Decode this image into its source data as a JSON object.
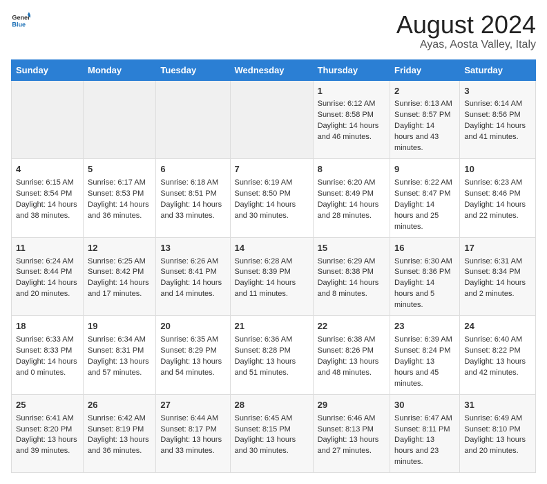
{
  "header": {
    "logo_general": "General",
    "logo_blue": "Blue",
    "title": "August 2024",
    "subtitle": "Ayas, Aosta Valley, Italy"
  },
  "days_of_week": [
    "Sunday",
    "Monday",
    "Tuesday",
    "Wednesday",
    "Thursday",
    "Friday",
    "Saturday"
  ],
  "weeks": [
    [
      {
        "day": "",
        "content": ""
      },
      {
        "day": "",
        "content": ""
      },
      {
        "day": "",
        "content": ""
      },
      {
        "day": "",
        "content": ""
      },
      {
        "day": "1",
        "content": "Sunrise: 6:12 AM\nSunset: 8:58 PM\nDaylight: 14 hours and 46 minutes."
      },
      {
        "day": "2",
        "content": "Sunrise: 6:13 AM\nSunset: 8:57 PM\nDaylight: 14 hours and 43 minutes."
      },
      {
        "day": "3",
        "content": "Sunrise: 6:14 AM\nSunset: 8:56 PM\nDaylight: 14 hours and 41 minutes."
      }
    ],
    [
      {
        "day": "4",
        "content": "Sunrise: 6:15 AM\nSunset: 8:54 PM\nDaylight: 14 hours and 38 minutes."
      },
      {
        "day": "5",
        "content": "Sunrise: 6:17 AM\nSunset: 8:53 PM\nDaylight: 14 hours and 36 minutes."
      },
      {
        "day": "6",
        "content": "Sunrise: 6:18 AM\nSunset: 8:51 PM\nDaylight: 14 hours and 33 minutes."
      },
      {
        "day": "7",
        "content": "Sunrise: 6:19 AM\nSunset: 8:50 PM\nDaylight: 14 hours and 30 minutes."
      },
      {
        "day": "8",
        "content": "Sunrise: 6:20 AM\nSunset: 8:49 PM\nDaylight: 14 hours and 28 minutes."
      },
      {
        "day": "9",
        "content": "Sunrise: 6:22 AM\nSunset: 8:47 PM\nDaylight: 14 hours and 25 minutes."
      },
      {
        "day": "10",
        "content": "Sunrise: 6:23 AM\nSunset: 8:46 PM\nDaylight: 14 hours and 22 minutes."
      }
    ],
    [
      {
        "day": "11",
        "content": "Sunrise: 6:24 AM\nSunset: 8:44 PM\nDaylight: 14 hours and 20 minutes."
      },
      {
        "day": "12",
        "content": "Sunrise: 6:25 AM\nSunset: 8:42 PM\nDaylight: 14 hours and 17 minutes."
      },
      {
        "day": "13",
        "content": "Sunrise: 6:26 AM\nSunset: 8:41 PM\nDaylight: 14 hours and 14 minutes."
      },
      {
        "day": "14",
        "content": "Sunrise: 6:28 AM\nSunset: 8:39 PM\nDaylight: 14 hours and 11 minutes."
      },
      {
        "day": "15",
        "content": "Sunrise: 6:29 AM\nSunset: 8:38 PM\nDaylight: 14 hours and 8 minutes."
      },
      {
        "day": "16",
        "content": "Sunrise: 6:30 AM\nSunset: 8:36 PM\nDaylight: 14 hours and 5 minutes."
      },
      {
        "day": "17",
        "content": "Sunrise: 6:31 AM\nSunset: 8:34 PM\nDaylight: 14 hours and 2 minutes."
      }
    ],
    [
      {
        "day": "18",
        "content": "Sunrise: 6:33 AM\nSunset: 8:33 PM\nDaylight: 14 hours and 0 minutes."
      },
      {
        "day": "19",
        "content": "Sunrise: 6:34 AM\nSunset: 8:31 PM\nDaylight: 13 hours and 57 minutes."
      },
      {
        "day": "20",
        "content": "Sunrise: 6:35 AM\nSunset: 8:29 PM\nDaylight: 13 hours and 54 minutes."
      },
      {
        "day": "21",
        "content": "Sunrise: 6:36 AM\nSunset: 8:28 PM\nDaylight: 13 hours and 51 minutes."
      },
      {
        "day": "22",
        "content": "Sunrise: 6:38 AM\nSunset: 8:26 PM\nDaylight: 13 hours and 48 minutes."
      },
      {
        "day": "23",
        "content": "Sunrise: 6:39 AM\nSunset: 8:24 PM\nDaylight: 13 hours and 45 minutes."
      },
      {
        "day": "24",
        "content": "Sunrise: 6:40 AM\nSunset: 8:22 PM\nDaylight: 13 hours and 42 minutes."
      }
    ],
    [
      {
        "day": "25",
        "content": "Sunrise: 6:41 AM\nSunset: 8:20 PM\nDaylight: 13 hours and 39 minutes."
      },
      {
        "day": "26",
        "content": "Sunrise: 6:42 AM\nSunset: 8:19 PM\nDaylight: 13 hours and 36 minutes."
      },
      {
        "day": "27",
        "content": "Sunrise: 6:44 AM\nSunset: 8:17 PM\nDaylight: 13 hours and 33 minutes."
      },
      {
        "day": "28",
        "content": "Sunrise: 6:45 AM\nSunset: 8:15 PM\nDaylight: 13 hours and 30 minutes."
      },
      {
        "day": "29",
        "content": "Sunrise: 6:46 AM\nSunset: 8:13 PM\nDaylight: 13 hours and 27 minutes."
      },
      {
        "day": "30",
        "content": "Sunrise: 6:47 AM\nSunset: 8:11 PM\nDaylight: 13 hours and 23 minutes."
      },
      {
        "day": "31",
        "content": "Sunrise: 6:49 AM\nSunset: 8:10 PM\nDaylight: 13 hours and 20 minutes."
      }
    ]
  ]
}
